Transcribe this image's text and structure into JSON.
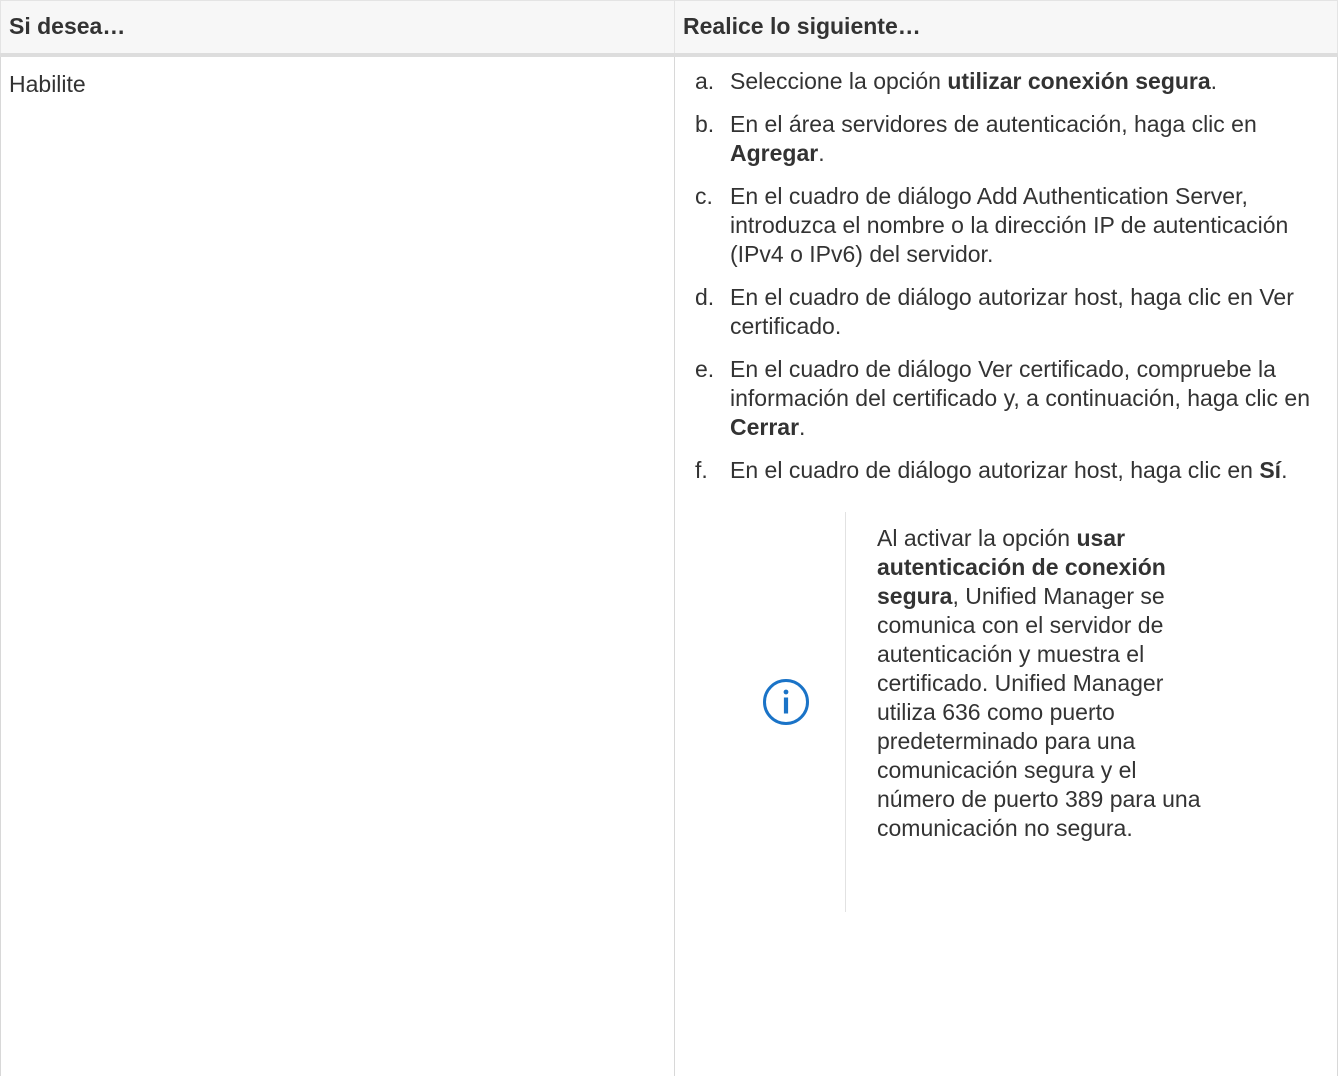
{
  "table": {
    "headers": [
      "Si desea…",
      "Realice lo siguiente…"
    ],
    "row": {
      "left": "Habilite",
      "steps": [
        {
          "marker": "a.",
          "parts": [
            "Seleccione la opción ",
            "utilizar conexión segura",
            "."
          ]
        },
        {
          "marker": "b.",
          "parts": [
            "En el área servidores de autenticación, haga clic en ",
            "Agregar",
            "."
          ]
        },
        {
          "marker": "c.",
          "parts": [
            "En el cuadro de diálogo Add Authentication Server, introduzca el nombre o la dirección IP de autenticación (IPv4 o IPv6) del servidor.",
            "",
            ""
          ]
        },
        {
          "marker": "d.",
          "parts": [
            "En el cuadro de diálogo autorizar host, haga clic en Ver certificado.",
            "",
            ""
          ]
        },
        {
          "marker": "e.",
          "parts": [
            "En el cuadro de diálogo Ver certificado, compruebe la información del certificado y, a continuación, haga clic en ",
            "Cerrar",
            "."
          ]
        },
        {
          "marker": "f.",
          "parts": [
            "En el cuadro de diálogo autorizar host, haga clic en ",
            "Sí",
            "."
          ]
        }
      ],
      "note": {
        "icon": "info-circle-icon",
        "icon_color": "#1a73c7",
        "pre": "Al activar la opción ",
        "bold": "usar autenticación de conexión segura",
        "post": ", Unified Manager se comunica con el servidor de autenticación y muestra el certificado. Unified Manager utiliza 636 como puerto predeterminado para una comunicación segura y el número de puerto 389 para una comunicación no segura."
      }
    }
  }
}
